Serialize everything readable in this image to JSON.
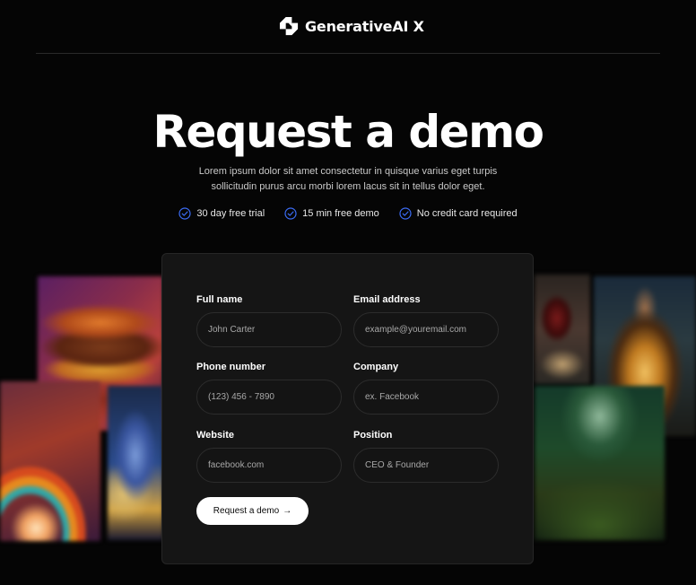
{
  "brand": {
    "name": "GenerativeAI X",
    "logo_icon": "generativeai-logo-icon"
  },
  "hero": {
    "title": "Request a demo",
    "subtitle": "Lorem ipsum dolor sit amet consectetur in quisque varius eget turpis sollicitudin purus arcu morbi lorem lacus sit in tellus dolor eget.",
    "perks": [
      {
        "label": "30 day free trial",
        "icon": "check-circle-icon"
      },
      {
        "label": "15 min free demo",
        "icon": "check-circle-icon"
      },
      {
        "label": "No credit card required",
        "icon": "check-circle-icon"
      }
    ]
  },
  "form": {
    "full_name": {
      "label": "Full name",
      "placeholder": "John Carter",
      "value": ""
    },
    "email": {
      "label": "Email address",
      "placeholder": "example@youremail.com",
      "value": ""
    },
    "phone": {
      "label": "Phone number",
      "placeholder": "(123) 456 - 7890",
      "value": ""
    },
    "company": {
      "label": "Company",
      "placeholder": "ex. Facebook",
      "value": ""
    },
    "website": {
      "label": "Website",
      "placeholder": "facebook.com",
      "value": ""
    },
    "position": {
      "label": "Position",
      "placeholder": "CEO & Founder",
      "value": ""
    },
    "submit_label": "Request a demo",
    "submit_icon": "arrow-right-icon"
  },
  "colors": {
    "background": "#050505",
    "card": "#151515",
    "accent_check": "#3b6cf5",
    "button": "#ffffff"
  }
}
